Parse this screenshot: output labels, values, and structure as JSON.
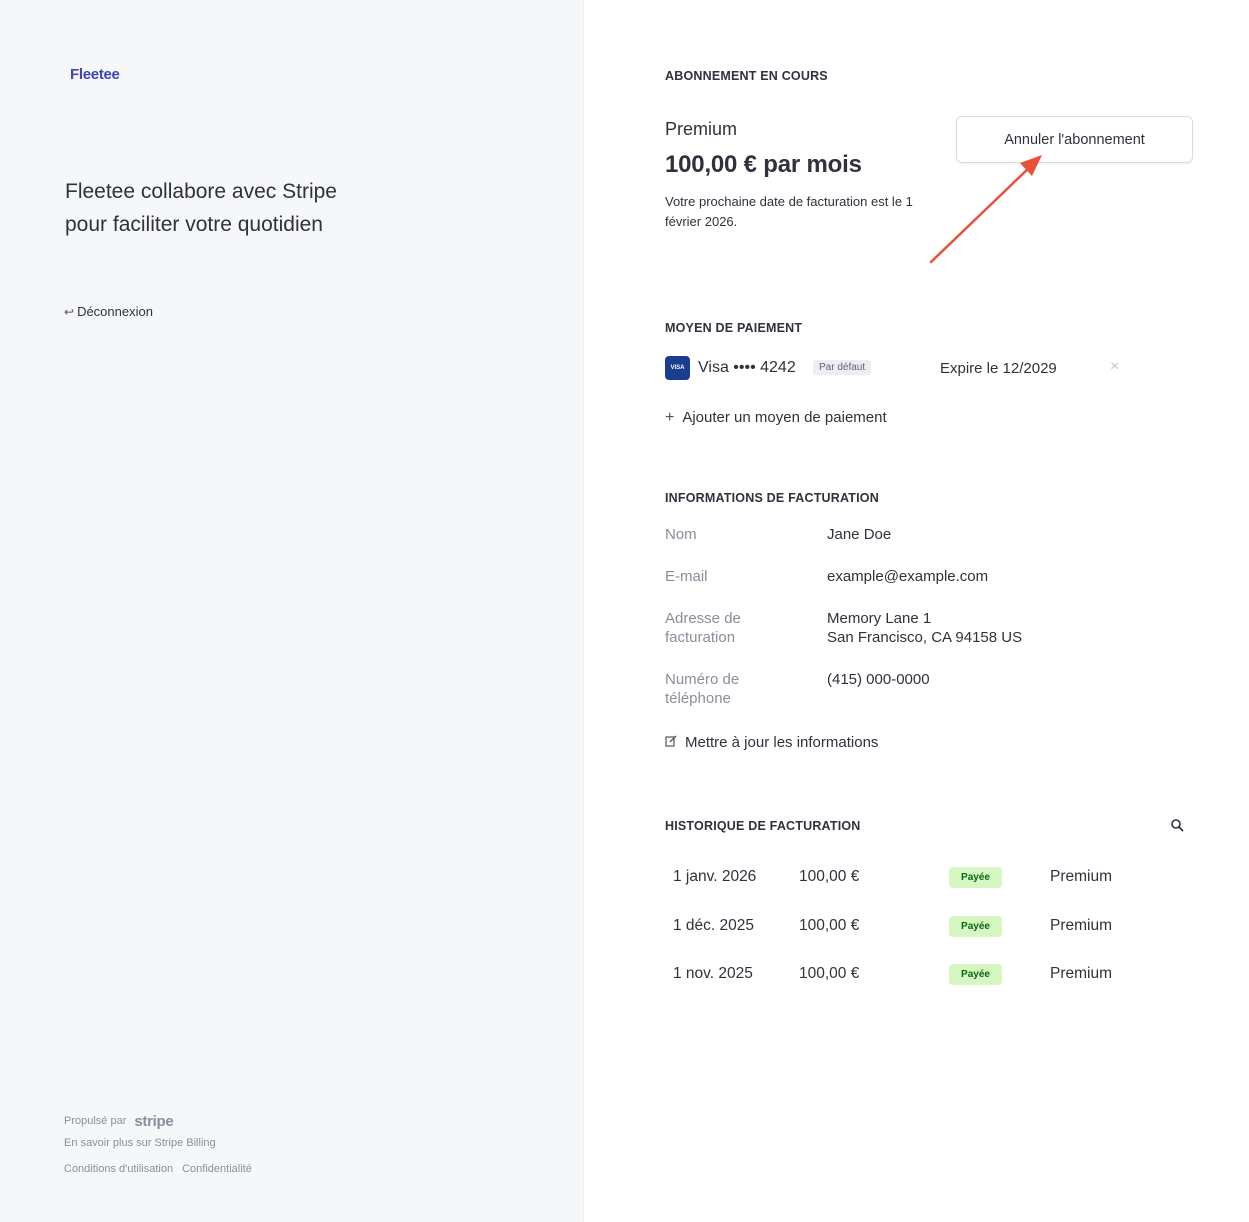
{
  "brand": {
    "logo_text": "Fleetee"
  },
  "left": {
    "tagline": "Fleetee collabore avec Stripe pour faciliter votre quotidien",
    "logout_label": "Déconnexion",
    "footer": {
      "powered_by": "Propulsé par",
      "stripe_word": "stripe",
      "learn_more": "En savoir plus sur Stripe Billing",
      "terms": "Conditions d'utilisation",
      "privacy": "Confidentialité"
    }
  },
  "subscription": {
    "title": "ABONNEMENT EN COURS",
    "plan_name": "Premium",
    "price": "100,00 € par mois",
    "next_billing": "Votre prochaine date de facturation est le 1 février 2026.",
    "cancel_label": "Annuler l'abonnement"
  },
  "payment": {
    "title": "MOYEN DE PAIEMENT",
    "card_icon": "visa-icon",
    "card_icon_text": "VISA",
    "card_label": "Visa •••• 4242",
    "default_badge": "Par défaut",
    "expiry": "Expire le 12/2029",
    "remove_symbol": "×",
    "add_label": "Ajouter un moyen de paiement"
  },
  "billing_info": {
    "title": "INFORMATIONS DE FACTURATION",
    "name_label": "Nom",
    "name_value": "Jane Doe",
    "email_label": "E-mail",
    "email_value": "example@example.com",
    "address_label": "Adresse de facturation",
    "address_line1": "Memory Lane 1",
    "address_line2": "San Francisco, CA 94158 US",
    "phone_label": "Numéro de téléphone",
    "phone_value": "(415) 000-0000",
    "update_label": "Mettre à jour les informations"
  },
  "history": {
    "title": "HISTORIQUE DE FACTURATION",
    "rows": [
      {
        "date": "1 janv. 2026",
        "amount": "100,00 €",
        "status": "Payée",
        "plan": "Premium"
      },
      {
        "date": "1 déc. 2025",
        "amount": "100,00 €",
        "status": "Payée",
        "plan": "Premium"
      },
      {
        "date": "1 nov. 2025",
        "amount": "100,00 €",
        "status": "Payée",
        "plan": "Premium"
      }
    ]
  },
  "colors": {
    "left_bg": "#f6f7f9",
    "text": "#30313d",
    "muted": "#8a8f9c",
    "badge_paid_bg": "#d7f7c2",
    "badge_paid_text": "#05690d",
    "annotation_arrow": "#e8503a",
    "visa_blue": "#1a3d8f"
  }
}
